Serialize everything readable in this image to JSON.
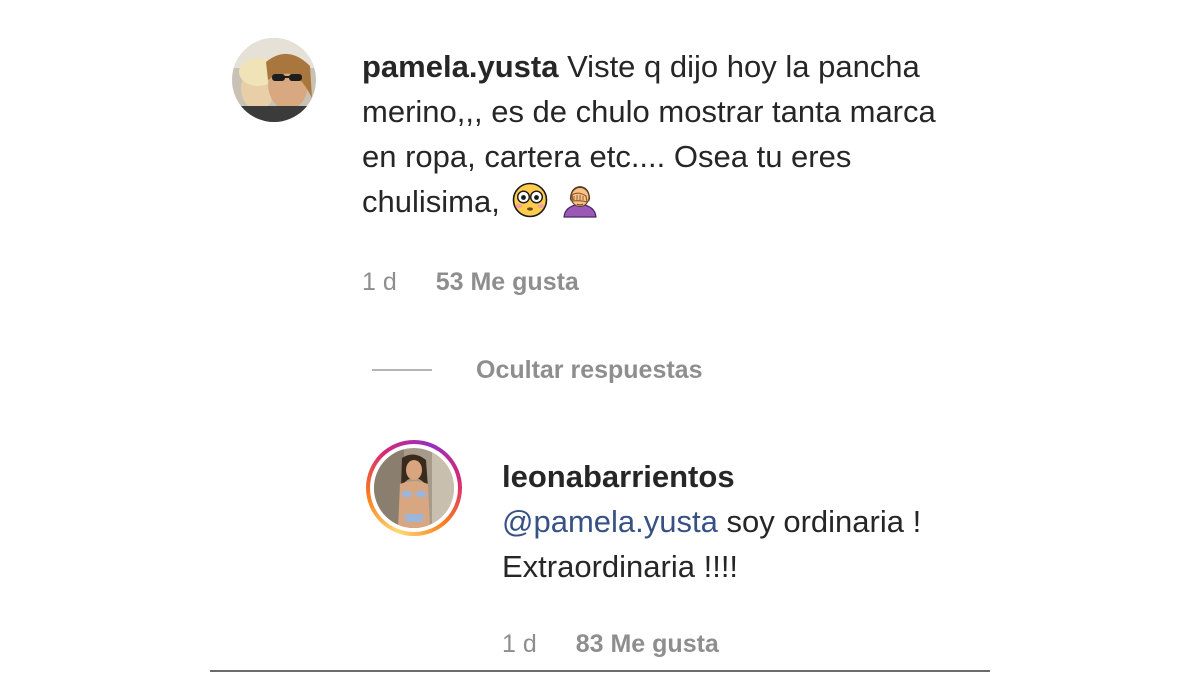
{
  "comment": {
    "username": "pamela.yusta",
    "text": "Viste q dijo hoy la pancha merino,,, es de chulo mostrar tanta marca en ropa, cartera etc.... Osea tu eres chulisima,",
    "emojis": [
      "flushed-face",
      "person-facepalming"
    ],
    "time": "1 d",
    "likes": "53 Me gusta"
  },
  "toggle_replies": {
    "label": "Ocultar respuestas"
  },
  "reply": {
    "username": "leonabarrientos",
    "mention": "@pamela.yusta",
    "text": " soy ordinaria ! Extraordinaria !!!!",
    "time": "1 d",
    "likes": "83 Me gusta",
    "has_story_ring": true
  },
  "colors": {
    "text": "#262626",
    "muted": "#8e8e8e",
    "mention": "#385185",
    "story_ring": [
      "#feda75",
      "#fa7e1e",
      "#d62976",
      "#962fbf"
    ]
  }
}
